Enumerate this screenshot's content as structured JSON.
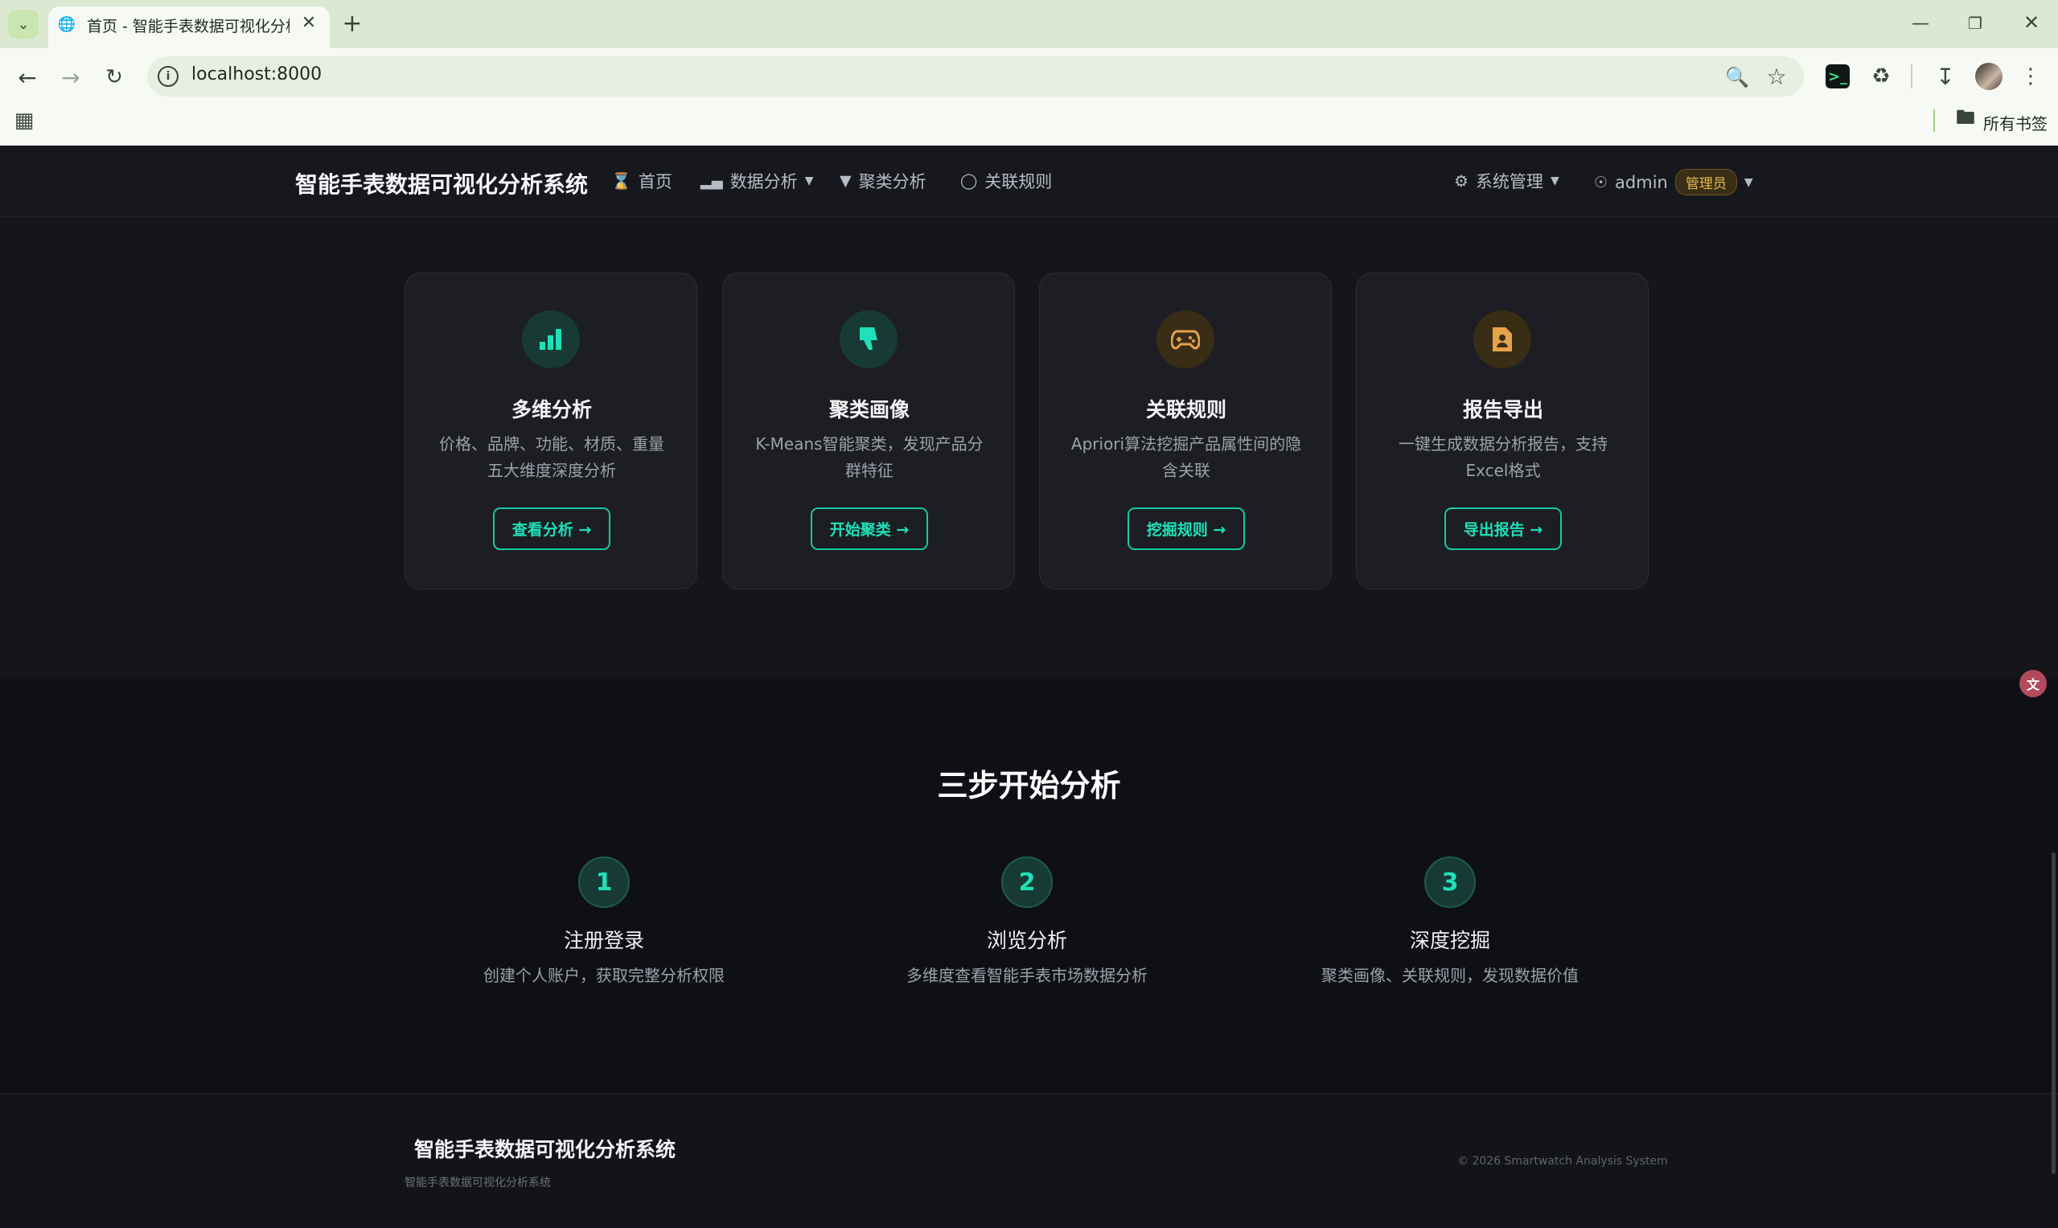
{
  "browser": {
    "tab_title": "首页 - 智能手表数据可视化分析",
    "new_tab_symbol": "+",
    "url": "localhost:8000",
    "bookmarks_folder": "所有书签"
  },
  "nav": {
    "brand": "智能手表数据可视化分析系统",
    "items": [
      {
        "label": "首页"
      },
      {
        "label": "数据分析"
      },
      {
        "label": "聚类分析"
      },
      {
        "label": "关联规则"
      }
    ],
    "system": "系统管理",
    "user": "admin",
    "role_badge": "管理员"
  },
  "features": [
    {
      "title": "多维分析",
      "desc_line1": "价格、品牌、功能、材质、重量",
      "desc_line2": "五大维度深度分析",
      "button": "查看分析 →",
      "icon": "bar-chart-icon",
      "accent": "#1fe0b8"
    },
    {
      "title": "聚类画像",
      "desc_line1": "K-Means智能聚类，发现产品分",
      "desc_line2": "群特征",
      "button": "开始聚类 →",
      "icon": "thumbs-down-icon",
      "accent": "#1fe0b8"
    },
    {
      "title": "关联规则",
      "desc_line1": "Apriori算法挖掘产品属性间的隐",
      "desc_line2": "含关联",
      "button": "挖掘规则 →",
      "icon": "gamepad-icon",
      "accent": "#e6a34a"
    },
    {
      "title": "报告导出",
      "desc_line1": "一键生成数据分析报告，支持",
      "desc_line2": "Excel格式",
      "button": "导出报告 →",
      "icon": "file-user-icon",
      "accent": "#e6a34a"
    }
  ],
  "steps": {
    "heading": "三步开始分析",
    "items": [
      {
        "num": "1",
        "title": "注册登录",
        "desc": "创建个人账户，获取完整分析权限"
      },
      {
        "num": "2",
        "title": "浏览分析",
        "desc": "多维度查看智能手表市场数据分析"
      },
      {
        "num": "3",
        "title": "深度挖掘",
        "desc": "聚类画像、关联规则，发现数据价值"
      }
    ]
  },
  "footer": {
    "title": "智能手表数据可视化分析系统",
    "subtitle": "智能手表数据可视化分析系统",
    "copyright": "© 2026 Smartwatch Analysis System"
  },
  "colors": {
    "accent": "#1fe0b8",
    "badge": "#e6b84a"
  }
}
